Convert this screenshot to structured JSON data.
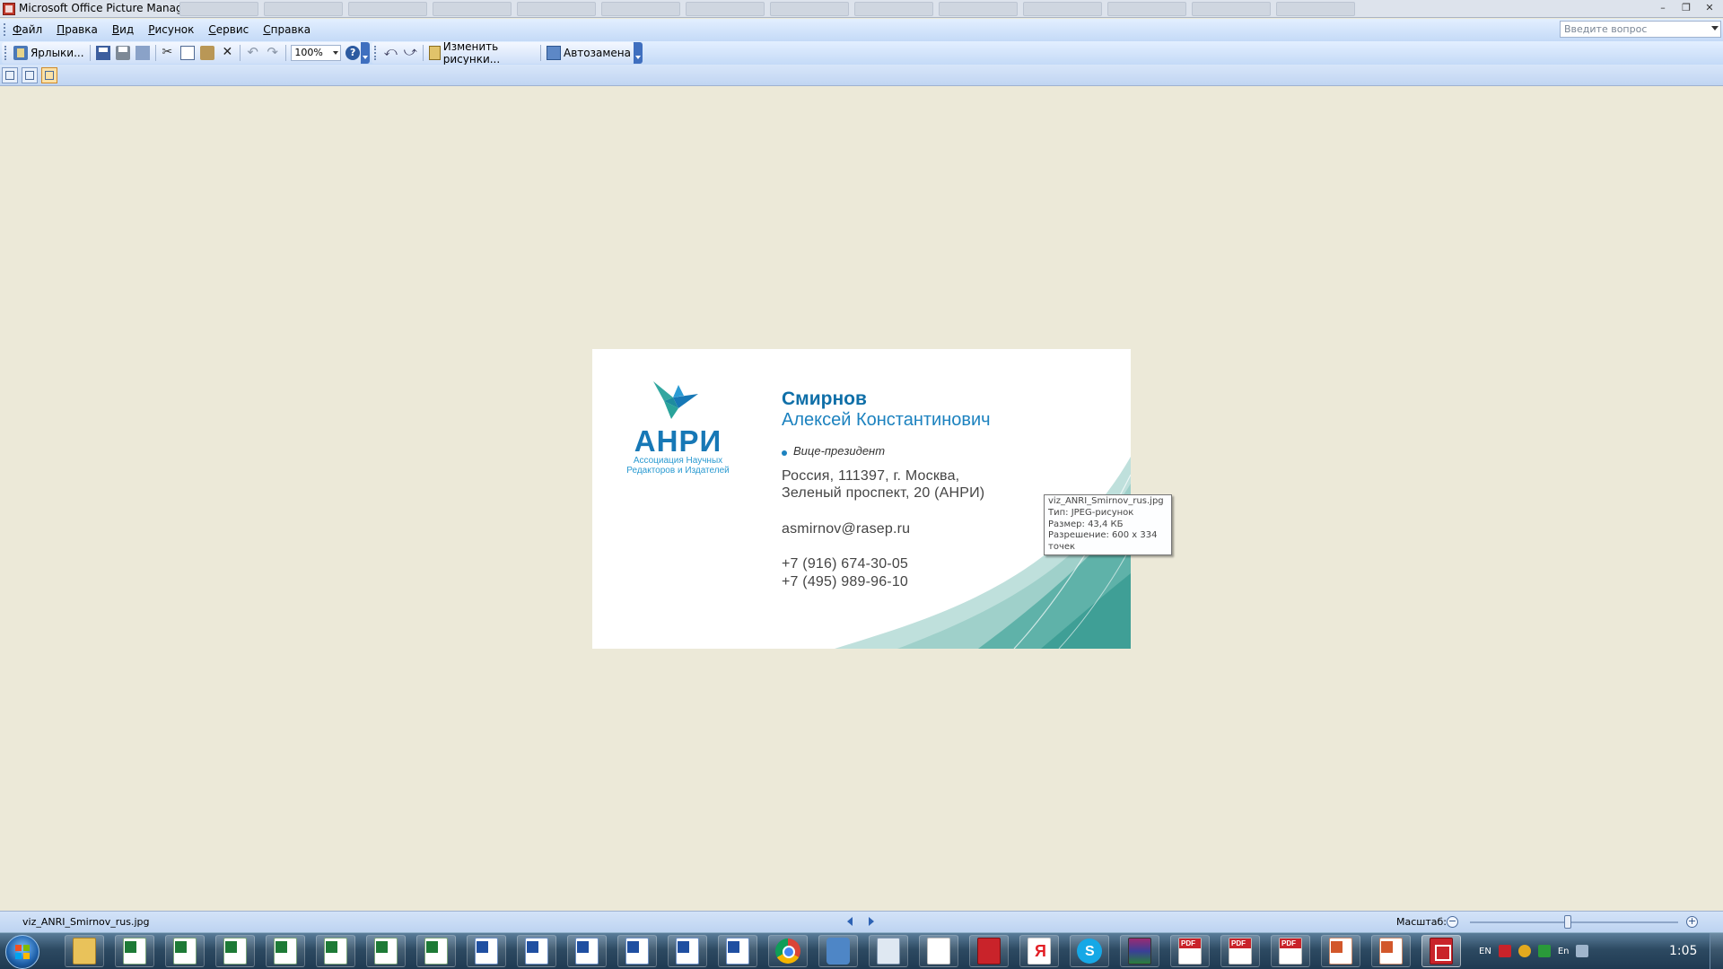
{
  "window": {
    "title": "Microsoft Office Picture Manager",
    "controls": [
      "–",
      "❐",
      "✕"
    ]
  },
  "menu": {
    "items": [
      "Файл",
      "Правка",
      "Вид",
      "Рисунок",
      "Сервис",
      "Справка"
    ],
    "ask_placeholder": "Введите вопрос"
  },
  "toolbar": {
    "shortcuts_label": "Ярлыки...",
    "zoom_value": "100%",
    "edit_pictures_label": "Изменить рисунки...",
    "autocorrect_label": "Автозамена"
  },
  "card": {
    "logo_text": "АНРИ",
    "logo_sub1": "Ассоциация Научных",
    "logo_sub2": "Редакторов и Издателей",
    "lastname": "Смирнов",
    "fullname": "Алексей Константинович",
    "position": "Вице-президент",
    "address1": "Россия, 111397, г. Москва,",
    "address2": "Зеленый проспект, 20 (АНРИ)",
    "email": "asmirnov@rasep.ru",
    "phone1": "+7 (916) 674-30-05",
    "phone2": "+7 (495) 989-96-10",
    "colors": {
      "primary": "#1778b6",
      "teal": "#4fa89f"
    }
  },
  "tooltip": {
    "lines": [
      "viz_ANRI_Smirnov_rus.jpg",
      "Тип: JPEG-рисунок",
      "Размер: 43,4 КБ",
      "Разрешение: 600 x 334",
      "точек"
    ]
  },
  "status": {
    "filename": "viz_ANRI_Smirnov_rus.jpg",
    "zoom_label": "Масштаб:",
    "zoom_level_fraction": 0.47
  },
  "taskbar": {
    "items": [
      {
        "type": "folder",
        "icon": "folder-icon"
      },
      {
        "type": "excel",
        "icon": "excel-icon"
      },
      {
        "type": "excel",
        "icon": "excel-icon"
      },
      {
        "type": "excel",
        "icon": "excel-icon"
      },
      {
        "type": "excel",
        "icon": "excel-icon"
      },
      {
        "type": "excel",
        "icon": "excel-icon"
      },
      {
        "type": "excel",
        "icon": "excel-icon"
      },
      {
        "type": "excel",
        "icon": "excel-icon"
      },
      {
        "type": "word",
        "icon": "word-icon"
      },
      {
        "type": "word",
        "icon": "word-icon"
      },
      {
        "type": "word",
        "icon": "word-icon"
      },
      {
        "type": "word",
        "icon": "word-icon"
      },
      {
        "type": "word",
        "icon": "word-icon"
      },
      {
        "type": "word",
        "icon": "word-icon"
      },
      {
        "type": "chrome",
        "icon": "chrome-icon"
      },
      {
        "type": "sound",
        "icon": "speaker-icon"
      },
      {
        "type": "calc",
        "icon": "calculator-icon"
      },
      {
        "type": "note",
        "icon": "blank-document-icon"
      },
      {
        "type": "book",
        "icon": "red-book-icon"
      },
      {
        "type": "yandex",
        "icon": "yandex-icon",
        "text": "Я"
      },
      {
        "type": "skype",
        "icon": "skype-icon",
        "text": "S"
      },
      {
        "type": "winrar",
        "icon": "winrar-icon"
      },
      {
        "type": "pdf",
        "icon": "pdf-icon",
        "text": "PDF"
      },
      {
        "type": "pdf",
        "icon": "pdf-icon",
        "text": "PDF"
      },
      {
        "type": "pdf",
        "icon": "pdf-icon",
        "text": "PDF"
      },
      {
        "type": "ppt",
        "icon": "powerpoint-icon"
      },
      {
        "type": "ppt",
        "icon": "powerpoint-icon"
      },
      {
        "type": "pm",
        "icon": "picture-manager-icon",
        "active": true
      }
    ],
    "tray_lang1": "EN",
    "tray_lang2": "En",
    "clock": "1:05"
  }
}
